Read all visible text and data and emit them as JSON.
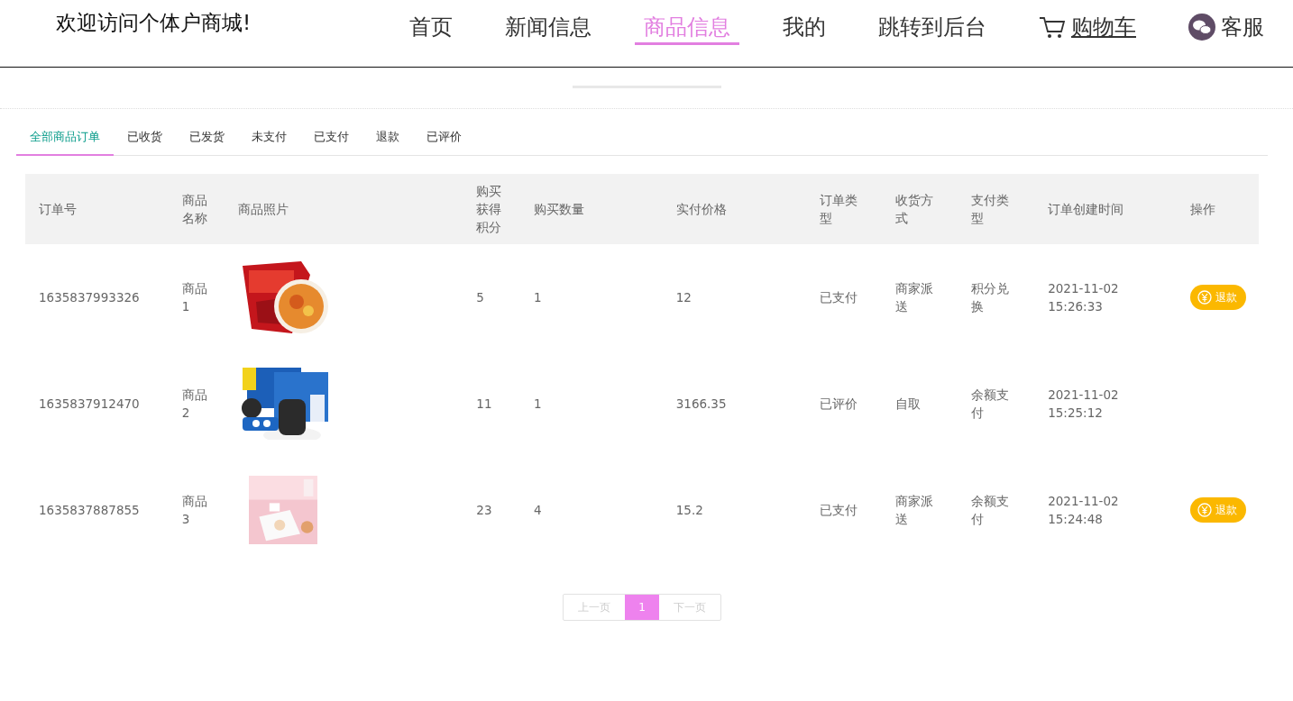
{
  "header": {
    "title": "欢迎访问个体户商城!",
    "nav": [
      {
        "label": "首页",
        "kind": "link",
        "selected": false,
        "hovered": false
      },
      {
        "label": "新闻信息",
        "kind": "link",
        "selected": false,
        "hovered": false
      },
      {
        "label": "商品信息",
        "kind": "link",
        "selected": true,
        "hovered": false
      },
      {
        "label": "我的",
        "kind": "link",
        "selected": false,
        "hovered": false
      },
      {
        "label": "跳转到后台",
        "kind": "link",
        "selected": false,
        "hovered": false
      },
      {
        "label": "购物车",
        "kind": "cart",
        "selected": false,
        "hovered": true
      },
      {
        "label": "客服",
        "kind": "service",
        "selected": false,
        "hovered": false
      }
    ]
  },
  "tabs": [
    {
      "label": "全部商品订单",
      "selected": true
    },
    {
      "label": "已收货",
      "selected": false
    },
    {
      "label": "已发货",
      "selected": false
    },
    {
      "label": "未支付",
      "selected": false
    },
    {
      "label": "已支付",
      "selected": false
    },
    {
      "label": "退款",
      "selected": false
    },
    {
      "label": "已评价",
      "selected": false
    }
  ],
  "table": {
    "columns": [
      "订单号",
      "商品名称",
      "商品照片",
      "购买获得积分",
      "购买数量",
      "实付价格",
      "订单类型",
      "收货方式",
      "支付类型",
      "订单创建时间",
      "操作"
    ],
    "rows": [
      {
        "order_no": "1635837993326",
        "name": "商品1",
        "points": "5",
        "quantity": "1",
        "price": "12",
        "order_type": "已支付",
        "delivery": "商家派送",
        "payment": "积分兑换",
        "created": "2021-11-02 15:26:33",
        "refund_button": "退款"
      },
      {
        "order_no": "1635837912470",
        "name": "商品2",
        "points": "11",
        "quantity": "1",
        "price": "3166.35",
        "order_type": "已评价",
        "delivery": "自取",
        "payment": "余额支付",
        "created": "2021-11-02 15:25:12"
      },
      {
        "order_no": "1635837887855",
        "name": "商品3",
        "points": "23",
        "quantity": "4",
        "price": "15.2",
        "order_type": "已支付",
        "delivery": "商家派送",
        "payment": "余额支付",
        "created": "2021-11-02 15:24:48",
        "refund_button": "退款"
      }
    ]
  },
  "pagination": {
    "prev": "上一页",
    "pages": [
      {
        "label": "1",
        "selected": true
      }
    ],
    "next": "下一页"
  }
}
